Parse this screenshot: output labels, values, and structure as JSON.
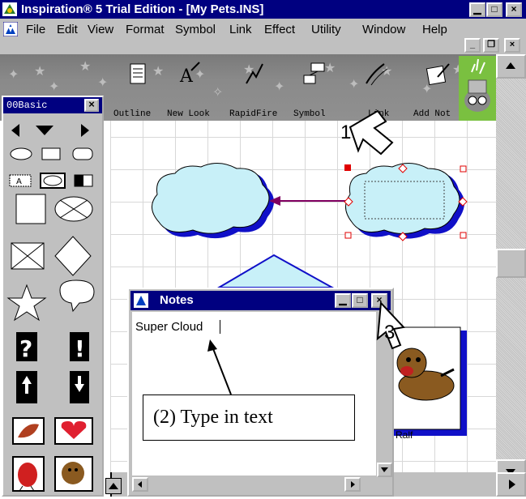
{
  "window": {
    "title": "Inspiration® 5 Trial Edition - [My Pets.INS]",
    "min_glyph": "▁",
    "max_glyph": "□",
    "close_glyph": "×"
  },
  "menu": {
    "items": [
      "File",
      "Edit",
      "View",
      "Format",
      "Symbol",
      "Link",
      "Effect",
      "Utility",
      "Window",
      "Help"
    ],
    "mdi_glyphs": [
      "_",
      "❐",
      "×"
    ]
  },
  "toolbar": {
    "buttons": [
      "Outline",
      "New Look",
      "RapidFire",
      "Symbol",
      "Link",
      "Add Not"
    ]
  },
  "palette": {
    "title": "00Basic",
    "close_glyph": "×"
  },
  "notes": {
    "title": "Notes",
    "text": "Super Cloud"
  },
  "diagram": {
    "symbol_label": "Ralf"
  },
  "annotations": {
    "step1": "1",
    "step3": "3",
    "callout": "(2) Type in text"
  },
  "colors": {
    "titlebar": "#000080",
    "cloud_fill": "#c8f0f8",
    "cloud_shadow": "#1010c8",
    "link_line": "#800060",
    "selection_handle": "#e00000"
  }
}
